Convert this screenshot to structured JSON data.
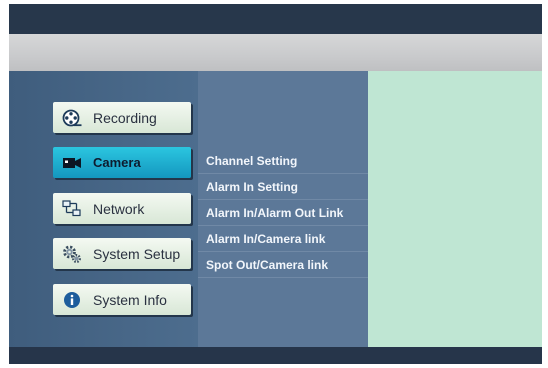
{
  "menu": {
    "items": [
      {
        "label": "Recording",
        "icon": "film-reel-icon"
      },
      {
        "label": "Camera",
        "icon": "camera-icon",
        "selected": true
      },
      {
        "label": "Network",
        "icon": "network-icon"
      },
      {
        "label": "System Setup",
        "icon": "gear-icon"
      },
      {
        "label": "System Info",
        "icon": "info-icon"
      }
    ]
  },
  "submenu": {
    "items": [
      "Channel Setting",
      "Alarm In Setting",
      "Alarm In/Alarm Out Link",
      "Alarm In/Camera link",
      "Spot Out/Camera link"
    ]
  },
  "colors": {
    "background": "#27374b",
    "title_bar": "#cfd0d2",
    "menu_button": "#e6f0e4",
    "menu_button_selected": "#1fb0d2",
    "submenu_panel": "#5c7898",
    "preview_panel": "#bfe6d3"
  }
}
